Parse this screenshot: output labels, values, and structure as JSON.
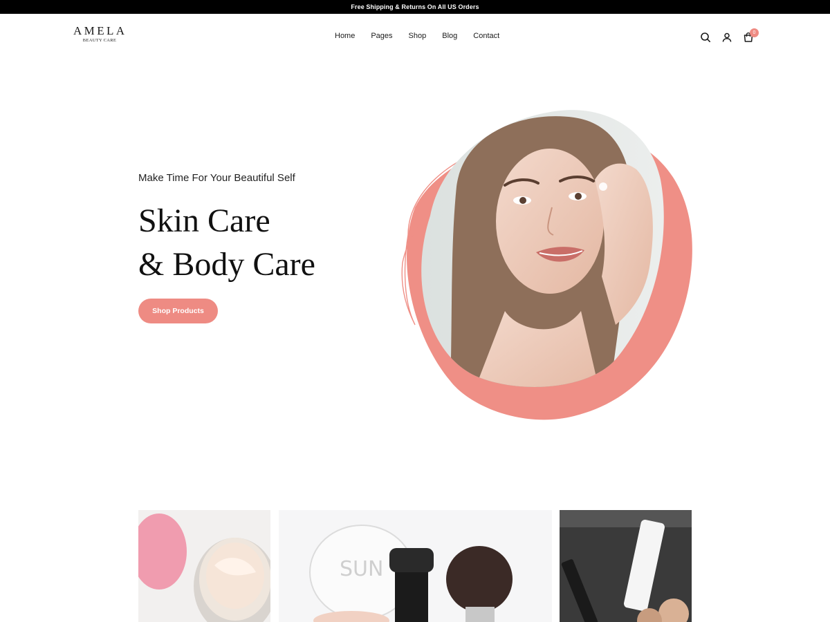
{
  "topbar": {
    "text": "Free Shipping & Returns On All US Orders"
  },
  "brand": {
    "name": "AMELA",
    "tagline": "BEAUTY CARE"
  },
  "nav": {
    "items": [
      {
        "label": "Home"
      },
      {
        "label": "Pages"
      },
      {
        "label": "Shop"
      },
      {
        "label": "Blog"
      },
      {
        "label": "Contact"
      }
    ]
  },
  "header_icons": {
    "search": "search-icon",
    "account": "user-icon",
    "cart": "cart-icon",
    "cart_count": "0"
  },
  "hero": {
    "subtitle": "Make Time For Your Beautiful Self",
    "title_line1": "Skin Care",
    "title_line2": "& Body Care",
    "button_label": "Shop Products",
    "image": "woman-applying-face-cream-photo"
  },
  "product_images": [
    {
      "image": "face-cream-jar-photo"
    },
    {
      "image": "makeup-brushes-and-powder-photo"
    },
    {
      "image": "kiko-cosmetics-products-photo"
    }
  ],
  "colors": {
    "accent": "#ee8b83",
    "topbar": "#000000",
    "text": "#111111"
  }
}
